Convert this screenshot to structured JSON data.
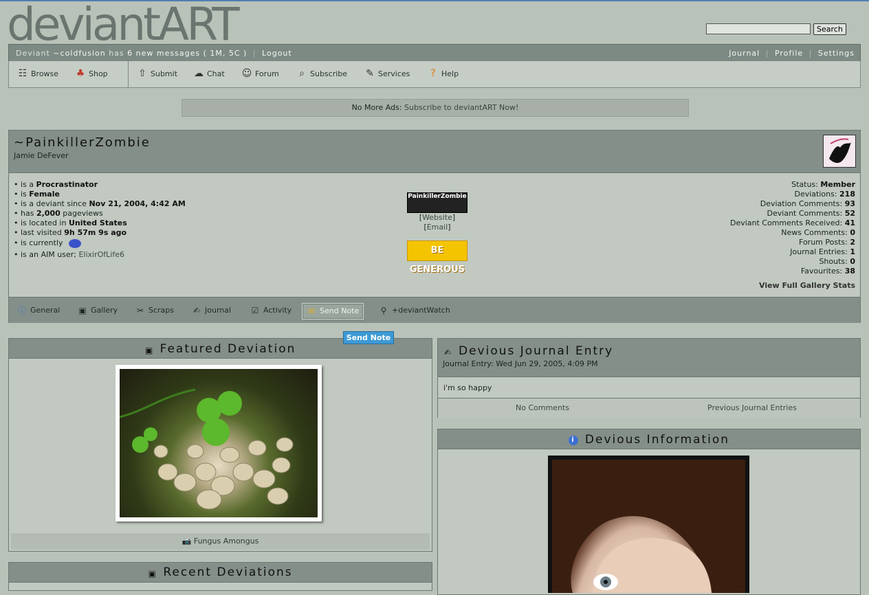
{
  "logo": "deviantART",
  "search": {
    "placeholder": "",
    "button_label": "Search"
  },
  "userbar": {
    "prefix": "Deviant",
    "username": "~coldfusion",
    "has": "has",
    "messages": "6 new messages",
    "counts": "( 1M, 5C )",
    "logout": "Logout",
    "links": [
      "Journal",
      "Profile",
      "Settings"
    ]
  },
  "nav": {
    "items": [
      {
        "label": "Browse",
        "icon": "browse-icon"
      },
      {
        "label": "Shop",
        "icon": "shop-icon"
      },
      {
        "label": "Submit",
        "icon": "submit-icon"
      },
      {
        "label": "Chat",
        "icon": "chat-icon"
      },
      {
        "label": "Forum",
        "icon": "forum-icon"
      },
      {
        "label": "Subscribe",
        "icon": "subscribe-icon"
      },
      {
        "label": "Services",
        "icon": "services-icon"
      },
      {
        "label": "Help",
        "icon": "help-icon"
      }
    ]
  },
  "ads": {
    "text": "No More Ads:",
    "link": "Subscribe to deviantART Now!"
  },
  "profile": {
    "name": "~PainkillerZombie",
    "realname": "Jamie DeFever",
    "facts": [
      {
        "pre": "is a",
        "val": "Procrastinator"
      },
      {
        "pre": "is",
        "val": "Female"
      },
      {
        "pre": "is a deviant since",
        "val": "Nov 21, 2004, 4:42 AM"
      },
      {
        "pre": "has",
        "val": "2,000",
        "post": "pageviews"
      },
      {
        "pre": "is located in",
        "val": "United States"
      },
      {
        "pre": "last visited",
        "val": "9h 57m 9s ago"
      },
      {
        "pre": "is currently"
      },
      {
        "pre": "is an AIM user;",
        "link": "ElixirOfLife6"
      }
    ],
    "website_image_text": "PainkillerZombie",
    "website_label": "Website",
    "email_label": "Email",
    "be_generous": "BE GENEROUS",
    "stats": [
      {
        "label": "Status:",
        "val": "Member"
      },
      {
        "label": "Deviations:",
        "val": "218"
      },
      {
        "label": "Deviation Comments:",
        "val": "93"
      },
      {
        "label": "Deviant Comments:",
        "val": "52"
      },
      {
        "label": "Deviant Comments Received:",
        "val": "41"
      },
      {
        "label": "News Comments:",
        "val": "0"
      },
      {
        "label": "Forum Posts:",
        "val": "2"
      },
      {
        "label": "Journal Entries:",
        "val": "1"
      },
      {
        "label": "Shouts:",
        "val": "0"
      },
      {
        "label": "Favourites:",
        "val": "38"
      }
    ],
    "view_stats": "View Full Gallery Stats",
    "tabs": [
      {
        "label": "General",
        "icon": "info-icon"
      },
      {
        "label": "Gallery",
        "icon": "gallery-icon"
      },
      {
        "label": "Scraps",
        "icon": "scraps-icon"
      },
      {
        "label": "Journal",
        "icon": "journal-icon"
      },
      {
        "label": "Activity",
        "icon": "activity-icon"
      },
      {
        "label": "Send Note",
        "icon": "note-icon"
      },
      {
        "label": "+deviantWatch",
        "icon": "watch-icon"
      }
    ],
    "tooltip": "Send Note"
  },
  "featured": {
    "title": "Featured Deviation",
    "caption": "Fungus Amongus"
  },
  "recent": {
    "title": "Recent Deviations"
  },
  "journal": {
    "title": "Devious Journal Entry",
    "subtitle": "Journal Entry: Wed Jun 29, 2005, 4:09 PM",
    "body": "i'm so happy",
    "comments": "No Comments",
    "previous": "Previous Journal Entries"
  },
  "information": {
    "title": "Devious Information"
  },
  "colors": {
    "accent": "#4f7fb0",
    "panel_header": "#848f89",
    "background": "#b9c2b8"
  }
}
